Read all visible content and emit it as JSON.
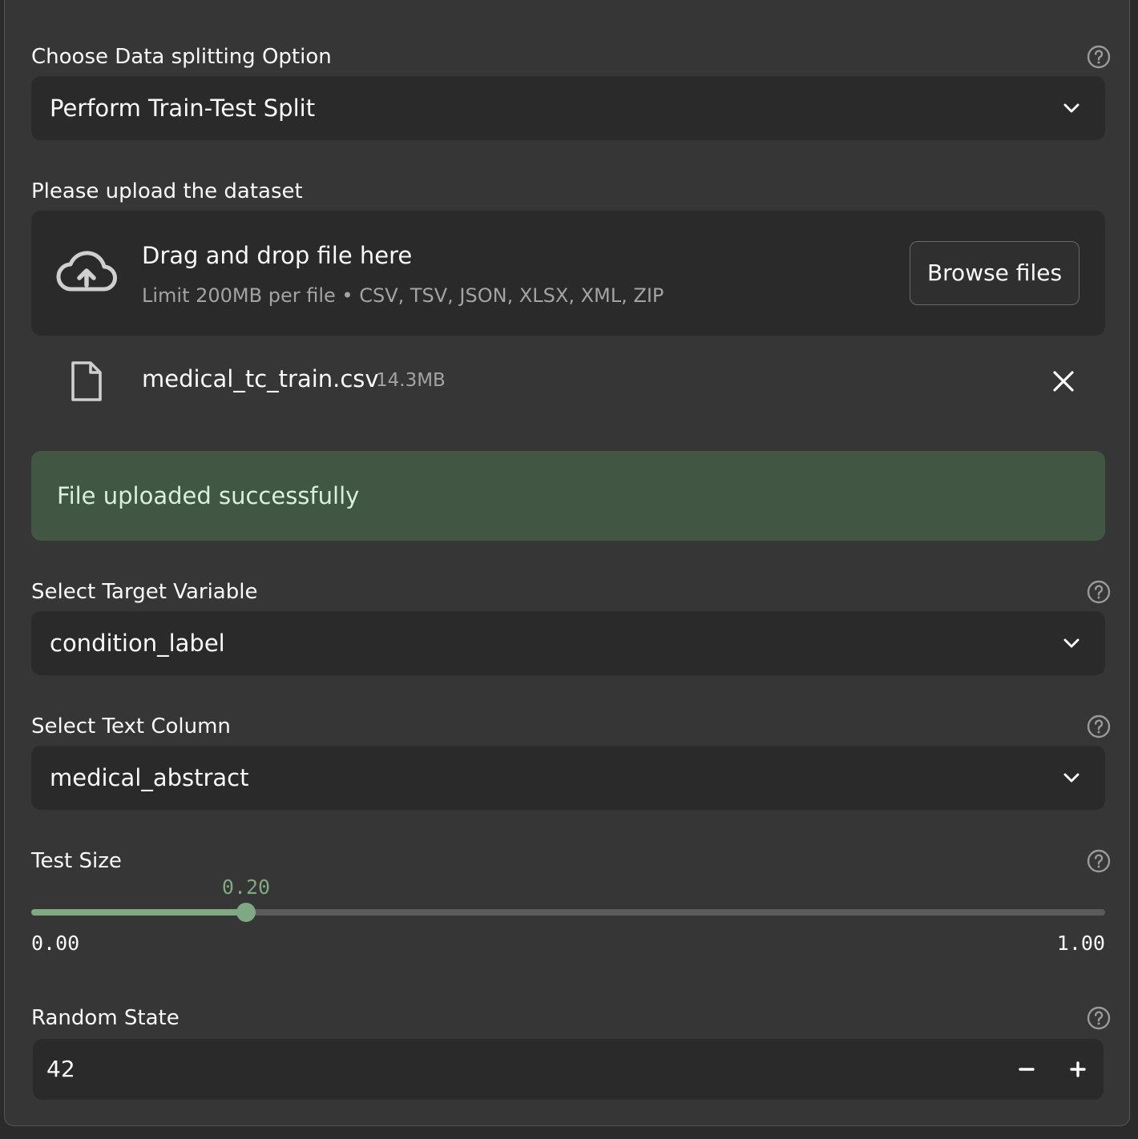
{
  "split_option": {
    "label": "Choose Data splitting Option",
    "selected": "Perform Train-Test Split"
  },
  "upload": {
    "label": "Please upload the dataset",
    "dropzone_title": "Drag and drop file here",
    "dropzone_limits": "Limit 200MB per file • CSV, TSV, JSON, XLSX, XML, ZIP",
    "browse_label": "Browse files",
    "file_name": "medical_tc_train.csv",
    "file_size": "14.3MB",
    "success_message": "File uploaded successfully"
  },
  "target_variable": {
    "label": "Select Target Variable",
    "selected": "condition_label"
  },
  "text_column": {
    "label": "Select Text Column",
    "selected": "medical_abstract"
  },
  "test_size": {
    "label": "Test Size",
    "value": 0.2,
    "value_text": "0.20",
    "min_text": "0.00",
    "max_text": "1.00",
    "min": 0,
    "max": 1
  },
  "random_state": {
    "label": "Random State",
    "value": "42"
  },
  "icons": {
    "help": "help-circle-icon",
    "chevron": "chevron-down-icon",
    "upload": "cloud-upload-icon",
    "file": "file-icon",
    "close": "close-icon",
    "minus": "minus-icon",
    "plus": "plus-icon"
  },
  "colors": {
    "accent": "#7fa883",
    "success_bg": "#415643",
    "panel_bg": "#363636",
    "input_bg": "#2a2a2a"
  }
}
